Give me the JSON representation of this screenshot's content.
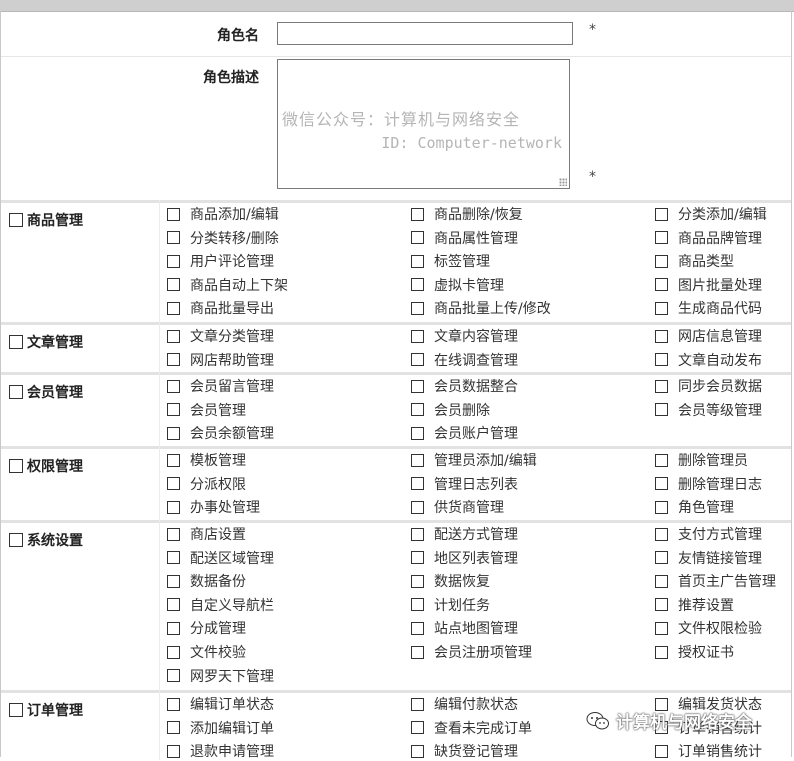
{
  "form": {
    "role_name_label": "角色名",
    "role_name_value": "",
    "role_desc_label": "角色描述",
    "role_desc_value": "",
    "required_mark": "*"
  },
  "watermark": {
    "line1": "微信公众号：计算机与网络安全",
    "line2": "ID: Computer-network"
  },
  "sections": [
    {
      "title": "商品管理",
      "items": [
        "商品添加/编辑",
        "商品删除/恢复",
        "分类添加/编辑",
        "分类转移/删除",
        "商品属性管理",
        "商品品牌管理",
        "用户评论管理",
        "标签管理",
        "商品类型",
        "商品自动上下架",
        "虚拟卡管理",
        "图片批量处理",
        "商品批量导出",
        "商品批量上传/修改",
        "生成商品代码"
      ]
    },
    {
      "title": "文章管理",
      "items": [
        "文章分类管理",
        "文章内容管理",
        "网店信息管理",
        "网店帮助管理",
        "在线调查管理",
        "文章自动发布"
      ]
    },
    {
      "title": "会员管理",
      "items": [
        "会员留言管理",
        "会员数据整合",
        "同步会员数据",
        "会员管理",
        "会员删除",
        "会员等级管理",
        "会员余额管理",
        "会员账户管理"
      ]
    },
    {
      "title": "权限管理",
      "items": [
        "模板管理",
        "管理员添加/编辑",
        "删除管理员",
        "分派权限",
        "管理日志列表",
        "删除管理日志",
        "办事处管理",
        "供货商管理",
        "角色管理"
      ]
    },
    {
      "title": "系统设置",
      "items": [
        "商店设置",
        "配送方式管理",
        "支付方式管理",
        "配送区域管理",
        "地区列表管理",
        "友情链接管理",
        "数据备份",
        "数据恢复",
        "首页主广告管理",
        "自定义导航栏",
        "计划任务",
        "推荐设置",
        "分成管理",
        "站点地图管理",
        "文件权限检验",
        "文件校验",
        "会员注册项管理",
        "授权证书",
        "网罗天下管理"
      ]
    },
    {
      "title": "订单管理",
      "items": [
        "编辑订单状态",
        "编辑付款状态",
        "编辑发货状态",
        "添加编辑订单",
        "查看未完成订单",
        "订单销售统计",
        "退款申请管理",
        "缺货登记管理",
        "订单销售统计"
      ]
    }
  ],
  "badge": {
    "text": "计算机与网络安全"
  }
}
